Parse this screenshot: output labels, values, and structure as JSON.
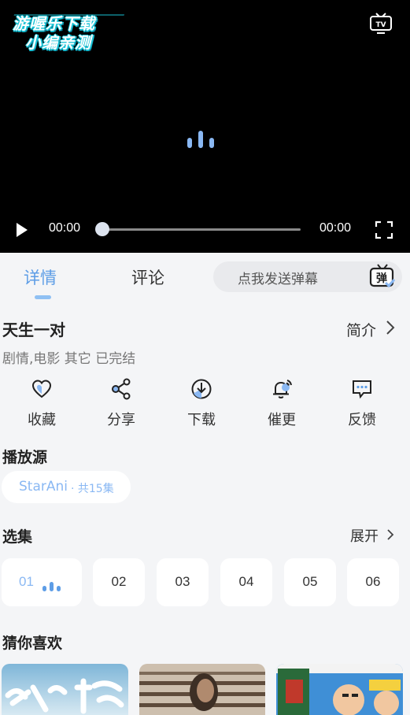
{
  "player": {
    "watermark_line1": "游喔乐下载",
    "watermark_line2": "小编亲测",
    "current_time": "00:00",
    "duration": "00:00",
    "progress": 0
  },
  "tabs": [
    {
      "label": "详情",
      "active": true
    },
    {
      "label": "评论",
      "active": false
    }
  ],
  "danmu": {
    "placeholder": "点我发送弹幕",
    "icon_text": "弹"
  },
  "show": {
    "title": "天生一对",
    "intro_label": "简介",
    "meta": "剧情,电影 其它 已完结"
  },
  "actions": [
    {
      "label": "收藏",
      "icon": "heart-icon"
    },
    {
      "label": "分享",
      "icon": "share-icon"
    },
    {
      "label": "下载",
      "icon": "download-icon"
    },
    {
      "label": "催更",
      "icon": "bell-icon"
    },
    {
      "label": "反馈",
      "icon": "feedback-icon"
    }
  ],
  "source_section": {
    "title": "播放源",
    "source_name": "StarAni",
    "source_count": "· 共15集"
  },
  "episodes_section": {
    "title": "选集",
    "expand_label": "展开",
    "items": [
      "01",
      "02",
      "03",
      "04",
      "05",
      "06"
    ]
  },
  "recommend_section": {
    "title": "猜你喜欢"
  },
  "colors": {
    "accent": "#5d9de6",
    "accent_light": "#8ab8f3",
    "background": "#f4f5f7",
    "player_bg": "#000000"
  }
}
